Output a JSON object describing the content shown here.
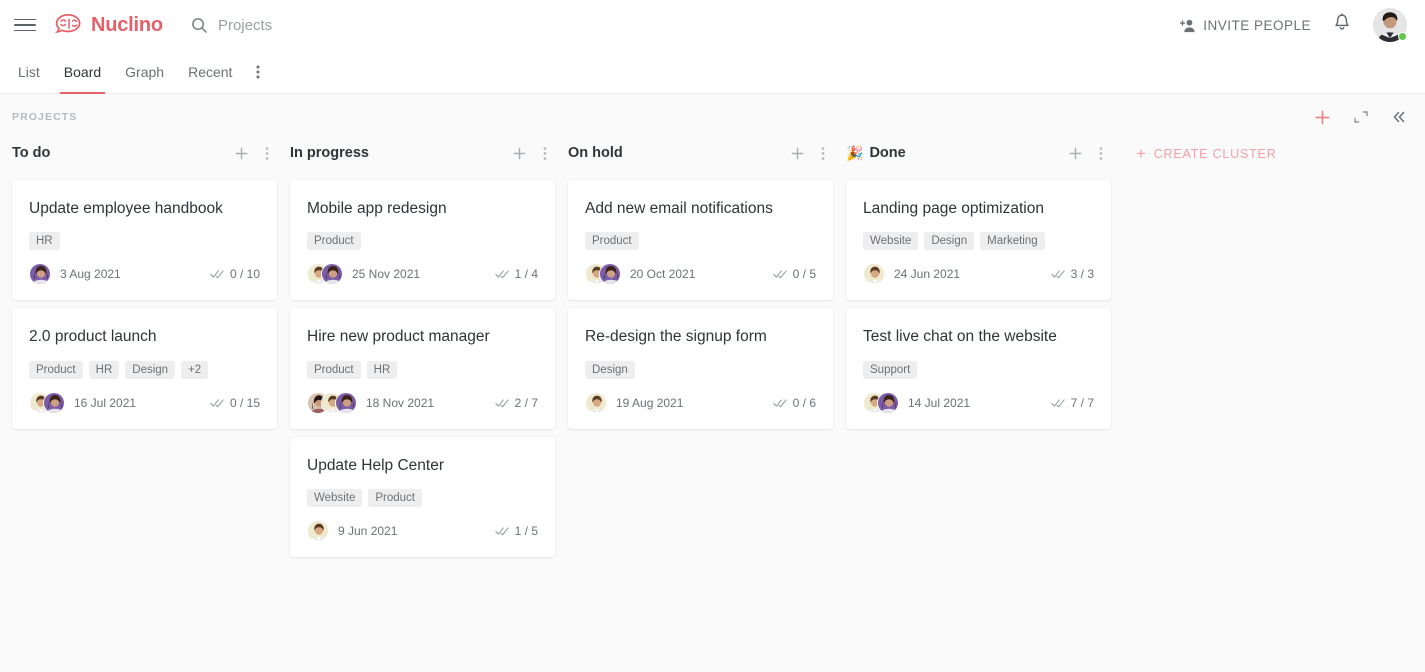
{
  "topbar": {
    "menu_icon": "hamburger-icon",
    "brand": "Nuclino",
    "brand_color": "#e4606a",
    "search_icon": "search-icon",
    "search_text": "Projects",
    "invite_label": "INVITE PEOPLE",
    "invite_icon": "add-person-icon",
    "notifications_icon": "bell-icon",
    "avatar": "user-avatar"
  },
  "tabs": {
    "items": [
      {
        "label": "List",
        "active": false
      },
      {
        "label": "Board",
        "active": true
      },
      {
        "label": "Graph",
        "active": false
      },
      {
        "label": "Recent",
        "active": false
      }
    ],
    "more_icon": "more-vertical-icon"
  },
  "board": {
    "label": "PROJECTS",
    "actions": [
      {
        "name": "add-item-icon",
        "glyph": "+",
        "color": "#e4606a"
      },
      {
        "name": "collapse-all-icon",
        "glyph": "┘",
        "color": "#9aa0a6"
      },
      {
        "name": "chevrons-left-icon",
        "glyph": "«",
        "color": "#6b7176"
      }
    ],
    "create_cluster_label": "CREATE CLUSTER",
    "create_cluster_plus": "+",
    "columns": [
      {
        "title": "To do",
        "emoji": "",
        "cards": [
          {
            "title": "Update employee handbook",
            "tags": [
              "HR"
            ],
            "avatars": [
              "woman-purple"
            ],
            "date": "3 Aug 2021",
            "tasks": "0 / 10"
          },
          {
            "title": "2.0 product launch",
            "tags": [
              "Product",
              "HR",
              "Design",
              "+2"
            ],
            "avatars": [
              "man-cream",
              "woman-purple"
            ],
            "date": "16 Jul 2021",
            "tasks": "0 / 15"
          }
        ]
      },
      {
        "title": "In progress",
        "emoji": "",
        "cards": [
          {
            "title": "Mobile app redesign",
            "tags": [
              "Product"
            ],
            "avatars": [
              "man-cream",
              "woman-purple"
            ],
            "date": "25 Nov 2021",
            "tasks": "1 / 4"
          },
          {
            "title": "Hire new product manager",
            "tags": [
              "Product",
              "HR"
            ],
            "avatars": [
              "woman-dark",
              "man-cream",
              "woman-purple"
            ],
            "date": "18 Nov 2021",
            "tasks": "2 / 7"
          },
          {
            "title": "Update Help Center",
            "tags": [
              "Website",
              "Product"
            ],
            "avatars": [
              "man-cream"
            ],
            "date": "9 Jun 2021",
            "tasks": "1 / 5"
          }
        ]
      },
      {
        "title": "On hold",
        "emoji": "",
        "cards": [
          {
            "title": "Add new email notifications",
            "tags": [
              "Product"
            ],
            "avatars": [
              "man-cream",
              "woman-purple"
            ],
            "date": "20 Oct 2021",
            "tasks": "0 / 5"
          },
          {
            "title": "Re-design the signup form",
            "tags": [
              "Design"
            ],
            "avatars": [
              "man-cream"
            ],
            "date": "19 Aug 2021",
            "tasks": "0 / 6"
          }
        ]
      },
      {
        "title": "Done",
        "emoji": "🎉",
        "cards": [
          {
            "title": "Landing page optimization",
            "tags": [
              "Website",
              "Design",
              "Marketing"
            ],
            "avatars": [
              "man-cream"
            ],
            "date": "24 Jun 2021",
            "tasks": "3 / 3"
          },
          {
            "title": "Test live chat on the website",
            "tags": [
              "Support"
            ],
            "avatars": [
              "man-cream",
              "woman-purple"
            ],
            "date": "14 Jul 2021",
            "tasks": "7 / 7"
          }
        ]
      }
    ],
    "column_add_icon": "plus-icon",
    "column_more_icon": "more-vertical-icon",
    "card_tasks_icon": "double-check-icon"
  }
}
